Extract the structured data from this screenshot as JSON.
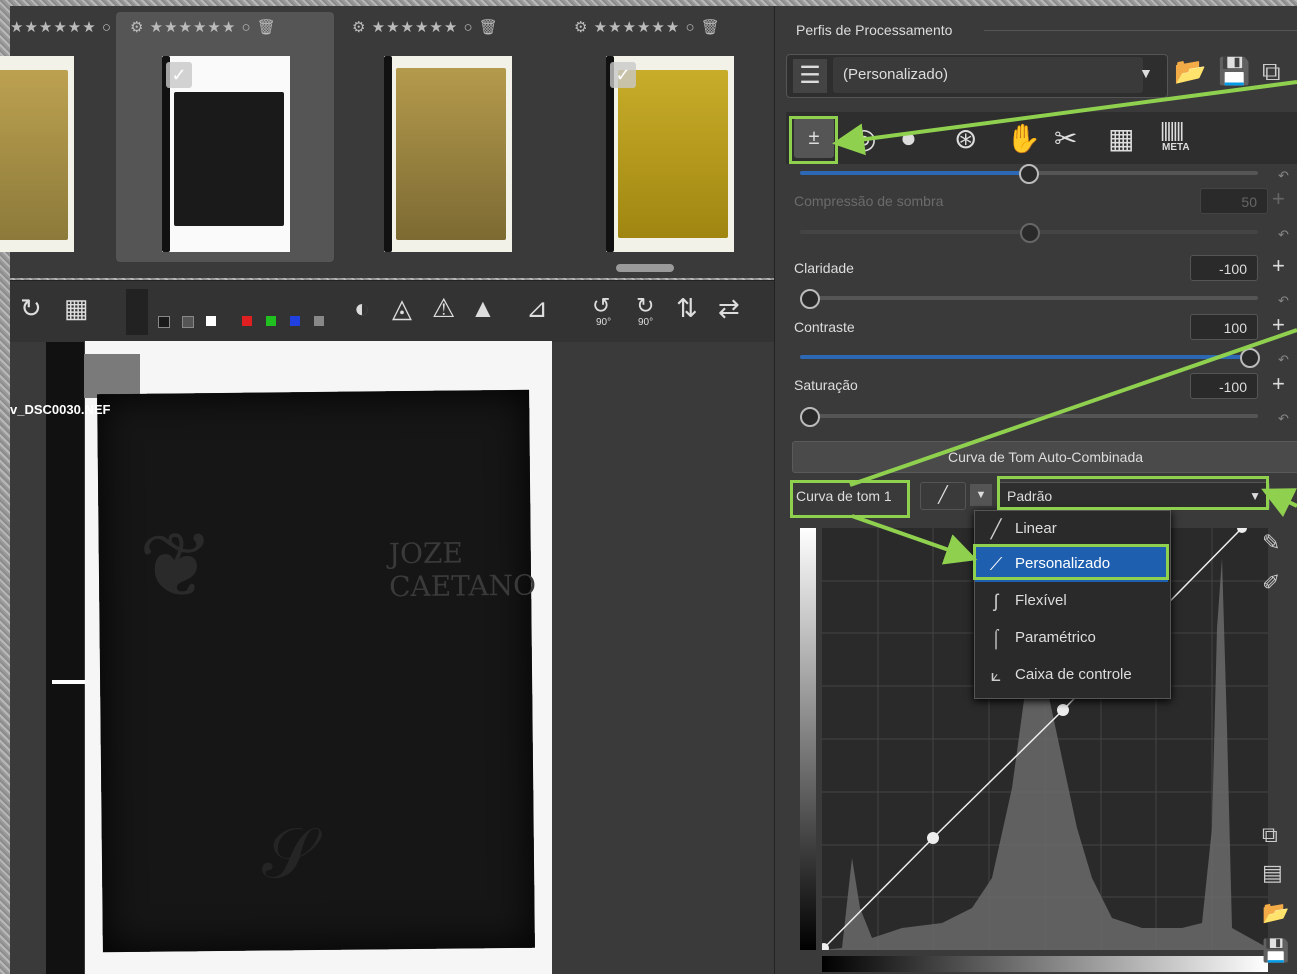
{
  "preview": {
    "filename": "v_DSC0030.NEF",
    "doc_text": "JOZE CAETANO"
  },
  "filmstrip": {
    "thumbs": [
      {
        "rating": "★★★★★★",
        "state": "partial",
        "checked": false
      },
      {
        "rating": "★★★★★★",
        "state": "selected",
        "checked": true
      },
      {
        "rating": "★★★★★★",
        "state": "normal",
        "checked": false
      },
      {
        "rating": "★★★★★★",
        "state": "normal",
        "checked": true
      }
    ],
    "toolbar_icons": [
      "gear-icon",
      "star-icon",
      "circle-icon",
      "trash-icon"
    ]
  },
  "panel": {
    "profile_section_title": "Perfis de Processamento",
    "profile_value": "(Personalizado)",
    "shadow_compression": {
      "label": "Compressão de sombra",
      "value": "50"
    },
    "clarity": {
      "label": "Claridade",
      "value": "-100"
    },
    "contrast": {
      "label": "Contraste",
      "value": "100"
    },
    "saturation": {
      "label": "Saturação",
      "value": "-100"
    },
    "auto_button": "Curva de Tom Auto-Combinada",
    "curve_label": "Curva de tom 1",
    "curve_mode": "Padrão",
    "meta_tab": "META"
  },
  "dropdown": {
    "items": [
      {
        "label": "Linear",
        "icon": "linear-icon"
      },
      {
        "label": "Personalizado",
        "icon": "custom-curve-icon",
        "selected": true
      },
      {
        "label": "Flexível",
        "icon": "flexible-icon"
      },
      {
        "label": "Paramétrico",
        "icon": "parametric-icon"
      },
      {
        "label": "Caixa de controle",
        "icon": "control-cage-icon"
      }
    ]
  },
  "toolbar": {
    "rotate_labels": [
      "90°",
      "90°"
    ]
  },
  "colors": {
    "accent_highlight": "#8fd14f",
    "selection_blue": "#1f5fb0",
    "slider_blue": "#2c68b4"
  }
}
